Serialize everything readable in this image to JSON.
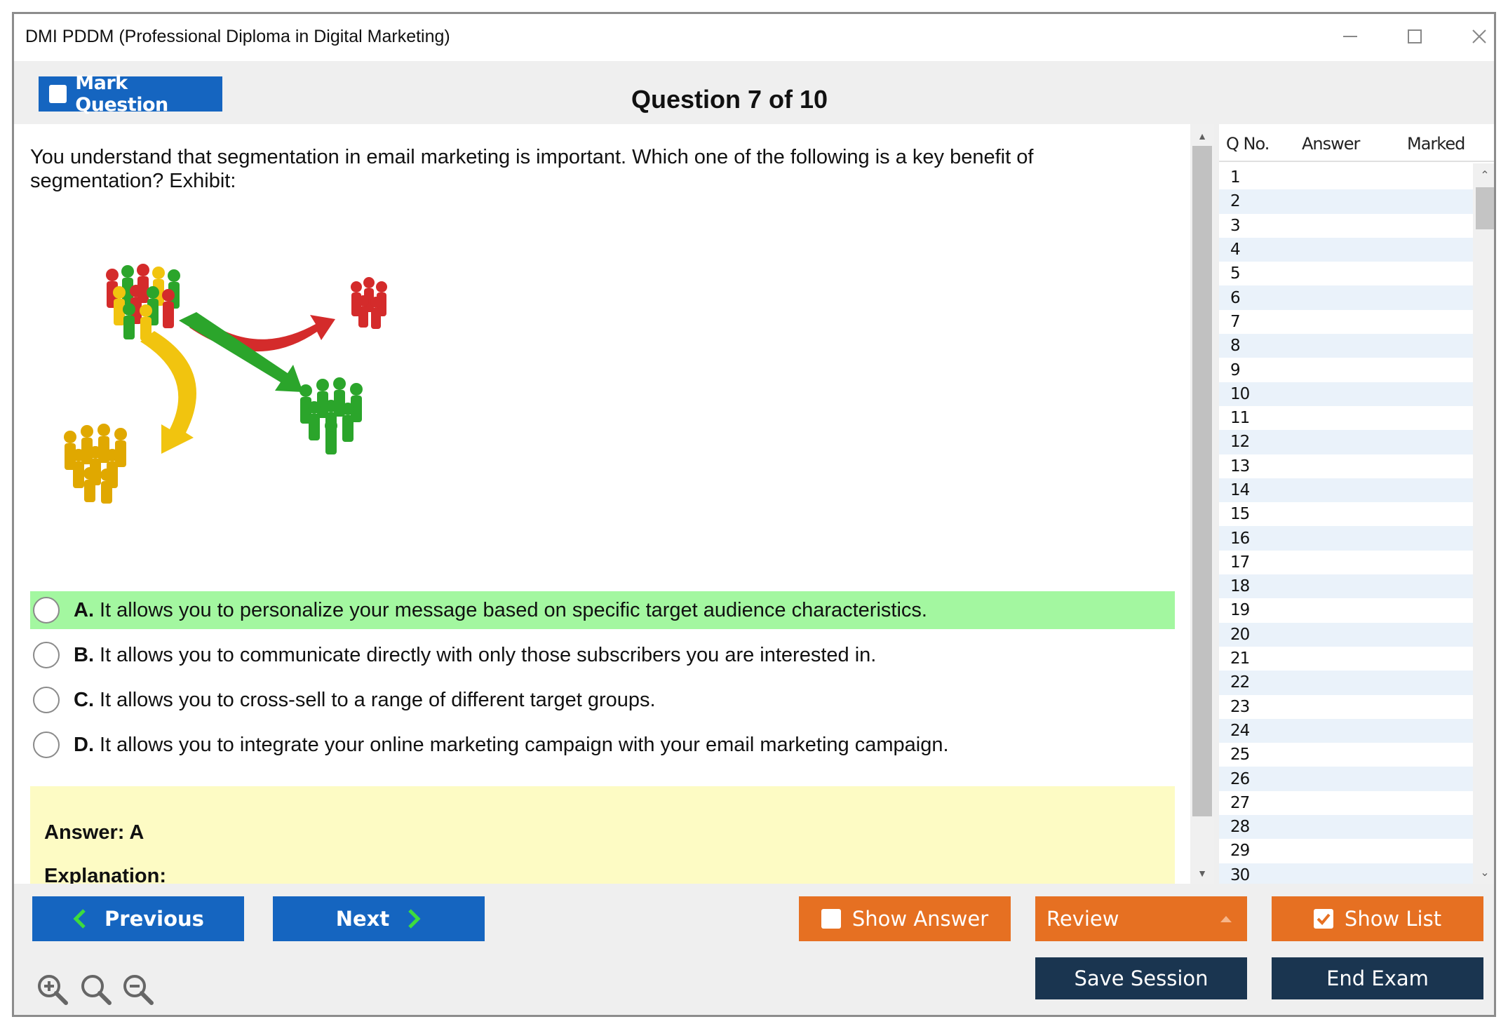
{
  "window": {
    "title": "DMI PDDM (Professional Diploma in Digital Marketing)"
  },
  "header": {
    "mark_label": "Mark Question",
    "question_title": "Question 7 of 10"
  },
  "question": {
    "text": "You understand that segmentation in email marketing is important. Which one of the following is a key benefit of segmentation? Exhibit:",
    "options": [
      {
        "letter": "A.",
        "text": "It allows you to personalize your message based on specific target audience characteristics."
      },
      {
        "letter": "B.",
        "text": "It allows you to communicate directly with only those subscribers you are interested in."
      },
      {
        "letter": "C.",
        "text": "It allows you to cross-sell to a range of different target groups."
      },
      {
        "letter": "D.",
        "text": "It allows you to integrate your online marketing campaign with your email marketing campaign."
      }
    ],
    "answer": "Answer: A",
    "explanation_label": "Explanation:"
  },
  "qlist": {
    "headers": {
      "qno": "Q No.",
      "answer": "Answer",
      "marked": "Marked"
    },
    "rows": [
      "1",
      "2",
      "3",
      "4",
      "5",
      "6",
      "7",
      "8",
      "9",
      "10",
      "11",
      "12",
      "13",
      "14",
      "15",
      "16",
      "17",
      "18",
      "19",
      "20",
      "21",
      "22",
      "23",
      "24",
      "25",
      "26",
      "27",
      "28",
      "29",
      "30"
    ]
  },
  "footer": {
    "previous": "Previous",
    "next": "Next",
    "show_answer": "Show Answer",
    "review": "Review",
    "show_list": "Show List",
    "save_session": "Save Session",
    "end_exam": "End Exam"
  },
  "colors": {
    "primary_blue": "#1565c0",
    "orange": "#e67022",
    "navy": "#1a3550",
    "correct_highlight": "#a3f7a0",
    "answer_box": "#fdfbc4"
  }
}
